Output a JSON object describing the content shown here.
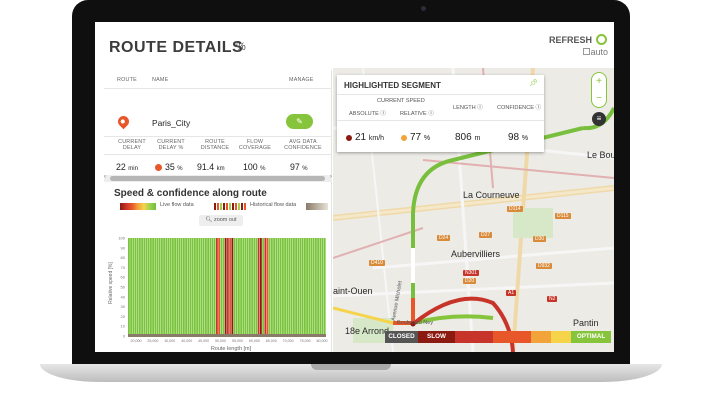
{
  "page": {
    "title": "ROUTE DETAILS",
    "refresh_label": "REFRESH",
    "auto_label": "auto"
  },
  "table": {
    "headers": {
      "route": "ROUTE",
      "name": "NAME",
      "manage": "MANAGE"
    },
    "route_name": "Paris_City",
    "stat_headers": [
      "CURRENT DELAY",
      "CURRENT DELAY %",
      "ROUTE DISTANCE",
      "FLOW COVERAGE",
      "AVG DATA CONFIDENCE"
    ],
    "stats": {
      "delay": "22",
      "delay_unit": "min",
      "delay_pct": "35",
      "delay_pct_unit": "%",
      "distance": "91.4",
      "distance_unit": "km",
      "coverage": "100",
      "coverage_unit": "%",
      "confidence": "97",
      "confidence_unit": "%"
    }
  },
  "chart": {
    "title": "Speed & confidence along route",
    "legend_live": "Live flow data",
    "legend_hist": "Historical flow data",
    "zoom_out": "zoom out",
    "ylabel": "Relative speed [%]",
    "xlabel": "Route length [m]"
  },
  "segment": {
    "title": "HIGHLIGHTED SEGMENT",
    "current_speed": "CURRENT SPEED",
    "absolute": "ABSOLUTE",
    "relative": "RELATIVE",
    "length": "LENGTH",
    "confidence": "CONFIDENCE",
    "abs_value": "21",
    "abs_unit": "km/h",
    "rel_value": "77",
    "rel_unit": "%",
    "len_value": "806",
    "len_unit": "m",
    "conf_value": "98",
    "conf_unit": "%"
  },
  "map": {
    "labels": [
      "La Courneuve",
      "Aubervilliers",
      "Le Bourget",
      "aint-Ouen",
      "18e Arrond",
      "Pantin",
      "Boulevard Ney",
      "Avenue Michelet"
    ],
    "roads": [
      "D114",
      "D24",
      "D27",
      "D30",
      "D410",
      "D932",
      "D20",
      "N301",
      "N2",
      "A1",
      "D115"
    ]
  },
  "congestion": {
    "closed": "CLOSED",
    "slow": "SLOW",
    "optimal": "OPTIMAL",
    "colors": {
      "closed": "#555555",
      "slow": "#8b1a10",
      "red": "#c7352a",
      "orange": "#e8572a",
      "amber": "#f2a33a",
      "yellow": "#f5d44a",
      "green": "#86c43b"
    }
  },
  "chart_data": {
    "type": "bar",
    "title": "Speed & confidence along route",
    "xlabel": "Route length [m]",
    "ylabel": "Relative speed [%]",
    "ylim": [
      0,
      100
    ],
    "xlim": [
      0,
      91400
    ],
    "yticks": [
      0,
      10,
      20,
      30,
      40,
      50,
      60,
      70,
      80,
      90,
      100
    ],
    "xticks": [
      "20,000",
      "25,000",
      "30,000",
      "40,000",
      "45,000",
      "50,000",
      "55,000",
      "60,000",
      "65,000",
      "70,000",
      "75,000",
      "80,000"
    ],
    "series": [
      {
        "name": "Live flow data",
        "values": [
          100,
          100,
          100,
          100,
          100,
          100,
          100,
          100,
          100,
          100,
          100,
          100,
          100,
          100,
          100,
          100,
          100,
          100,
          100,
          100,
          100,
          100,
          100,
          100,
          100,
          100,
          100,
          100,
          100,
          100,
          100,
          100,
          100,
          100,
          100,
          100,
          100,
          100,
          100,
          100,
          100,
          100,
          100,
          100,
          100,
          100,
          100,
          100,
          100,
          100,
          100,
          100,
          100,
          100,
          100,
          100,
          100,
          100,
          100,
          100,
          100,
          100,
          100,
          100,
          100,
          100,
          100,
          100,
          100,
          100,
          100,
          100,
          100,
          100,
          100,
          100,
          100,
          100,
          100,
          100,
          100,
          100,
          100,
          100,
          100,
          100,
          100,
          100,
          100,
          100
        ]
      }
    ]
  }
}
